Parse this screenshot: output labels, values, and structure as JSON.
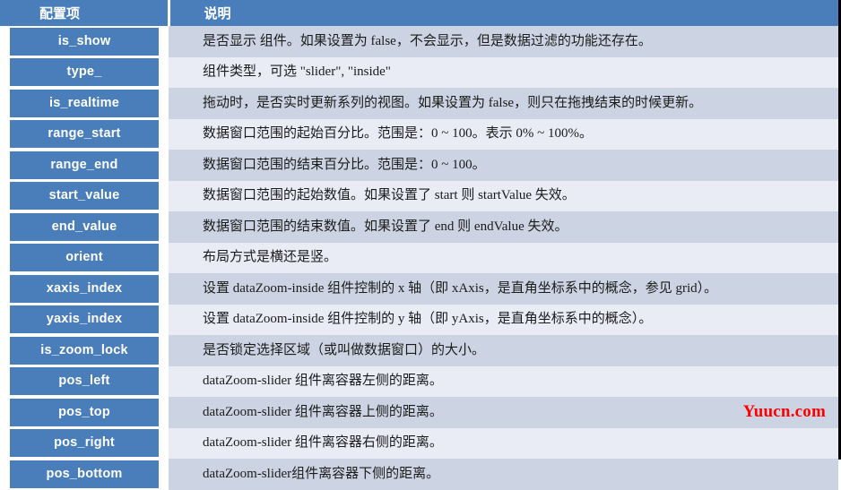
{
  "table": {
    "headers": {
      "key": "配置项",
      "desc": "说明"
    },
    "rows": [
      {
        "key": "is_show",
        "desc": "是否显示 组件。如果设置为 false，不会显示，但是数据过滤的功能还存在。"
      },
      {
        "key": "type_",
        "desc": "组件类型，可选 \"slider\", \"inside\""
      },
      {
        "key": "is_realtime",
        "desc": "拖动时，是否实时更新系列的视图。如果设置为 false，则只在拖拽结束的时候更新。"
      },
      {
        "key": "range_start",
        "desc": "数据窗口范围的起始百分比。范围是：0 ~ 100。表示 0% ~ 100%。"
      },
      {
        "key": "range_end",
        "desc": "数据窗口范围的结束百分比。范围是：0 ~ 100。"
      },
      {
        "key": "start_value",
        "desc": "数据窗口范围的起始数值。如果设置了 start 则 startValue 失效。"
      },
      {
        "key": "end_value",
        "desc": "数据窗口范围的结束数值。如果设置了 end 则 endValue 失效。"
      },
      {
        "key": "orient",
        "desc": "布局方式是横还是竖。"
      },
      {
        "key": "xaxis_index",
        "desc": "设置 dataZoom-inside 组件控制的 x 轴（即 xAxis，是直角坐标系中的概念，参见 grid）。"
      },
      {
        "key": "yaxis_index",
        "desc": "设置 dataZoom-inside 组件控制的 y 轴（即 yAxis，是直角坐标系中的概念）。"
      },
      {
        "key": "is_zoom_lock",
        "desc": "是否锁定选择区域（或叫做数据窗口）的大小。"
      },
      {
        "key": "pos_left",
        "desc": "dataZoom-slider 组件离容器左侧的距离。"
      },
      {
        "key": "pos_top",
        "desc": "dataZoom-slider 组件离容器上侧的距离。"
      },
      {
        "key": "pos_right",
        "desc": "dataZoom-slider 组件离容器右侧的距离。"
      },
      {
        "key": "pos_bottom",
        "desc": "dataZoom-slider组件离容器下侧的距离。"
      }
    ]
  },
  "watermark": {
    "text": "Yuucn.com",
    "color": "#ff0000"
  },
  "colors": {
    "header_blue": "#4a7ebb",
    "key_pill_blue": "#4a7ebb",
    "row_shade_dark": "#ccd4e3",
    "row_shade_light": "#e9ecf5",
    "border_dark": "#1a1a2e"
  }
}
